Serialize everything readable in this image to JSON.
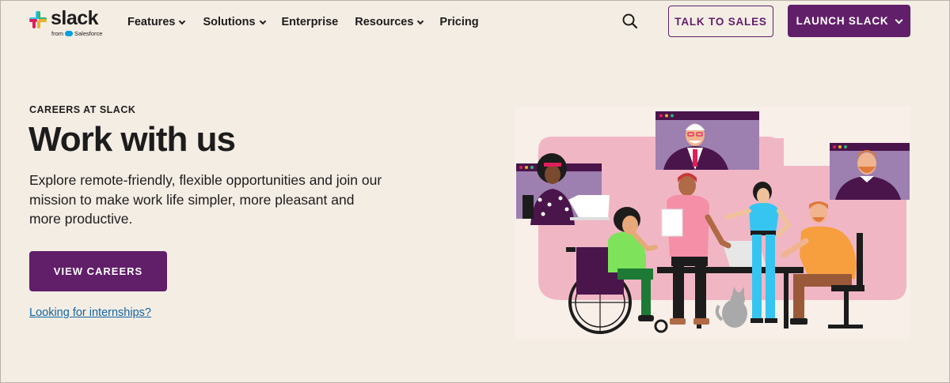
{
  "brand": {
    "name": "slack",
    "sub_from": "from",
    "sub_company": "Salesforce",
    "colors": {
      "primary": "#611f69",
      "background": "#f4ede4",
      "link": "#1264a3"
    }
  },
  "nav": {
    "items": [
      {
        "label": "Features",
        "has_dropdown": true
      },
      {
        "label": "Solutions",
        "has_dropdown": true
      },
      {
        "label": "Enterprise",
        "has_dropdown": false
      },
      {
        "label": "Resources",
        "has_dropdown": true
      },
      {
        "label": "Pricing",
        "has_dropdown": false
      }
    ],
    "search_icon": "search-icon",
    "talk_to_sales": "TALK TO SALES",
    "launch_slack": "LAUNCH SLACK"
  },
  "hero": {
    "eyebrow": "CAREERS AT SLACK",
    "title": "Work with us",
    "description": "Explore remote-friendly, flexible opportunities and join our mission to make work life simpler, more pleasant and more productive.",
    "cta": "VIEW CAREERS",
    "secondary_link": "Looking for internships?"
  }
}
